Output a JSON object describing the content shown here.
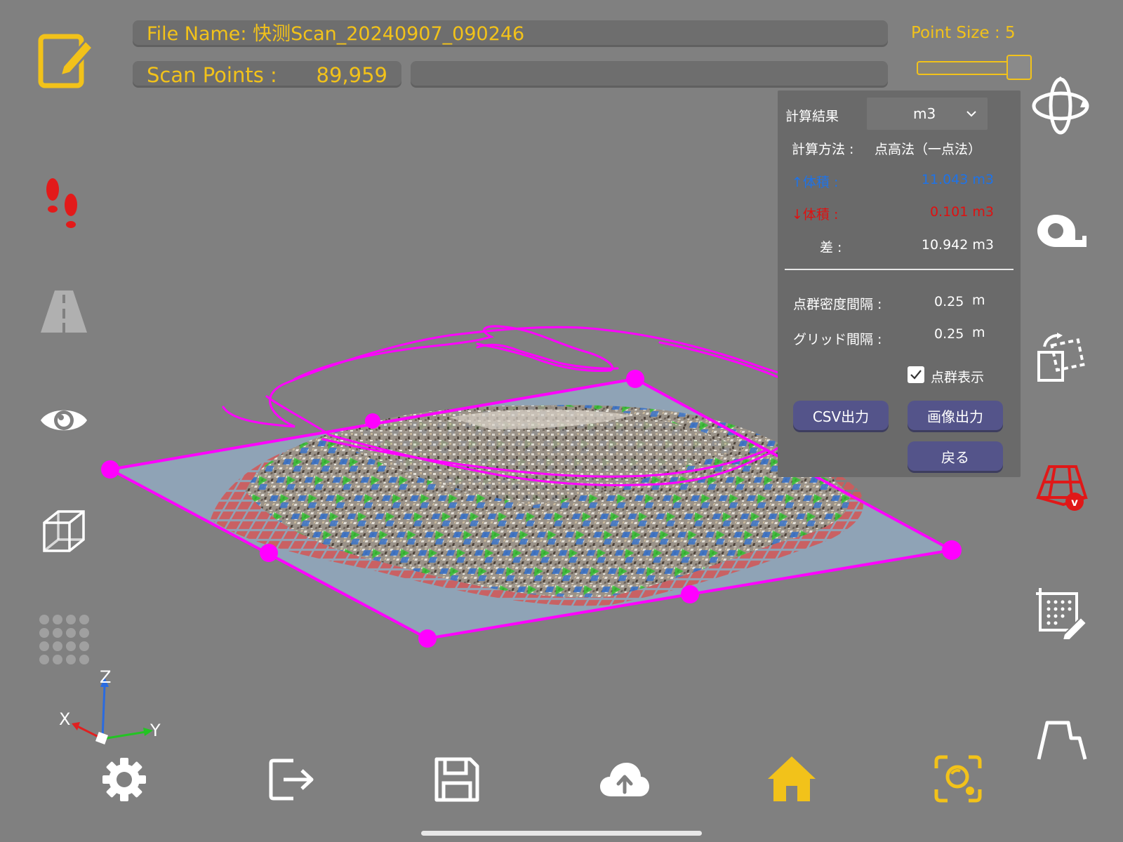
{
  "header": {
    "file_name": "File Name: 快测Scan_20240907_090246",
    "scan_points_label": "Scan Points :",
    "scan_points_value": "89,959",
    "point_size_label": "Point Size : ",
    "point_size_value": "5",
    "point_size_level": 0.9
  },
  "result_panel": {
    "title": "計算結果",
    "unit_selected": "m3",
    "method_label": "計算方法 :",
    "method_value": "点高法（一点法）",
    "vol_up_label": "↑体積 :",
    "vol_up_value": "11.043 m3",
    "vol_down_label": "↓体積 :",
    "vol_down_value": "0.101 m3",
    "diff_label": "差 :",
    "diff_value": "10.942 m3",
    "density_label": "点群密度間隔 :",
    "density_value": "0.25",
    "density_unit": "m",
    "grid_label": "グリッド間隔 :",
    "grid_value": "0.25",
    "grid_unit": "m",
    "show_points_label": "点群表示",
    "show_points_checked": true,
    "csv_button": "CSV出力",
    "image_button": "画像出力",
    "back_button": "戻る"
  },
  "axes": {
    "z": "Z",
    "x": "X",
    "y": "Y"
  },
  "colors": {
    "accent": "#f2c21a",
    "up_volume": "#1e73e8",
    "down_volume": "#e01010",
    "boundary": "#ff00ff",
    "button": "#54548a"
  },
  "icons": {
    "left": [
      "edit-icon",
      "footprints-icon",
      "road-icon",
      "eye-icon",
      "wireframe-cube-icon",
      "point-grid-icon"
    ],
    "right": [
      "orbit-rotate-icon",
      "tape-measure-icon",
      "transform-icon",
      "volume-mesh-icon",
      "grid-edit-icon",
      "profile-icon"
    ],
    "bottom": [
      "settings-icon",
      "export-icon",
      "save-icon",
      "cloud-upload-icon",
      "home-icon",
      "scan-camera-icon"
    ]
  }
}
